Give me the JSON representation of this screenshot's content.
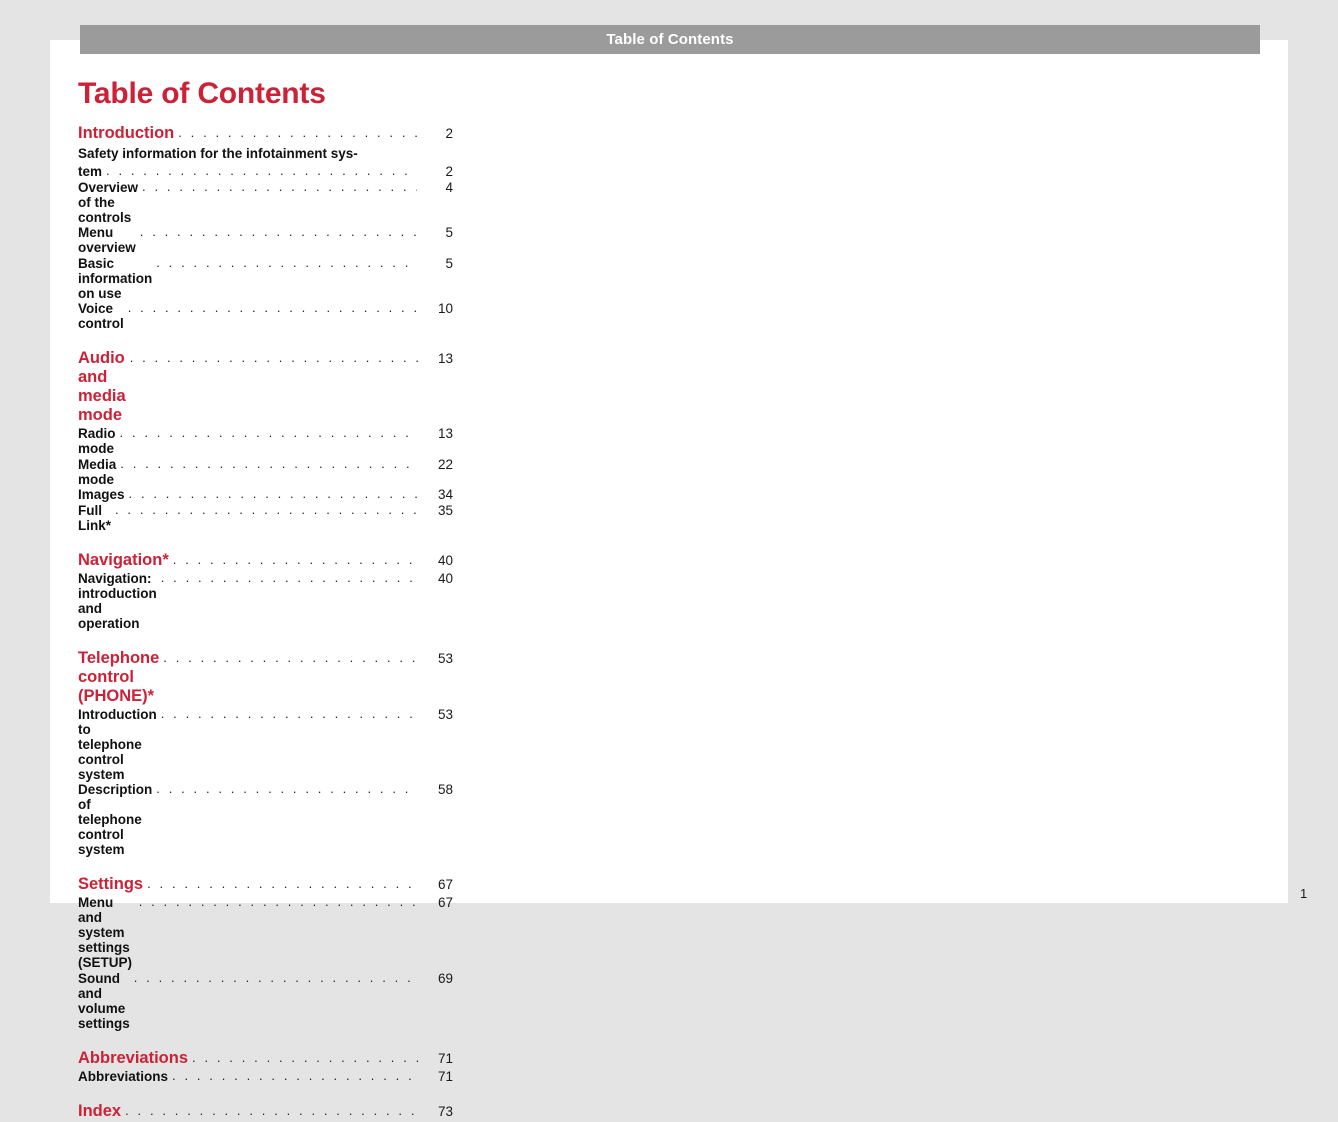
{
  "header": {
    "title": "Table of Contents",
    "bar_color": "#9b9b9b",
    "text_color": "#ffffff"
  },
  "page": {
    "number": "1",
    "background_color": "#e4e4e4",
    "sheet_color": "#ffffff",
    "accent_color": "#cc2136"
  },
  "toc": {
    "title": "Table of Contents",
    "sections": [
      {
        "label": "Introduction",
        "page": "2",
        "entries": [
          {
            "label": "Safety information for the infotainment sys-",
            "label_cont": "tem",
            "page": "2",
            "wrapped": true
          },
          {
            "label": "Overview of the controls",
            "page": "4",
            "wrapped": false
          },
          {
            "label": "Menu overview",
            "page": "5",
            "wrapped": false
          },
          {
            "label": "Basic information on use",
            "page": "5",
            "wrapped": false
          },
          {
            "label": "Voice control",
            "page": "10",
            "wrapped": false
          }
        ]
      },
      {
        "label": "Audio and media mode",
        "page": "13",
        "entries": [
          {
            "label": "Radio mode",
            "page": "13",
            "wrapped": false
          },
          {
            "label": "Media mode",
            "page": "22",
            "wrapped": false
          },
          {
            "label": "Images",
            "page": "34",
            "wrapped": false
          },
          {
            "label": "Full Link*",
            "page": "35",
            "wrapped": false
          }
        ]
      },
      {
        "label": "Navigation*",
        "page": "40",
        "entries": [
          {
            "label": "Navigation: introduction and operation",
            "page": "40",
            "wrapped": false
          }
        ]
      },
      {
        "label": "Telephone control (PHONE)*",
        "page": "53",
        "entries": [
          {
            "label": "Introduction to telephone control system",
            "page": "53",
            "wrapped": false
          },
          {
            "label": "Description of telephone control system",
            "page": "58",
            "wrapped": false
          }
        ]
      },
      {
        "label": "Settings",
        "page": "67",
        "entries": [
          {
            "label": "Menu and system settings (SETUP)",
            "page": "67",
            "wrapped": false
          },
          {
            "label": "Sound and volume settings",
            "page": "69",
            "wrapped": false
          }
        ]
      },
      {
        "label": "Abbreviations",
        "page": "71",
        "entries": [
          {
            "label": "Abbreviations",
            "page": "71",
            "wrapped": false
          }
        ]
      },
      {
        "label": "Index",
        "page": "73",
        "entries": []
      }
    ]
  }
}
